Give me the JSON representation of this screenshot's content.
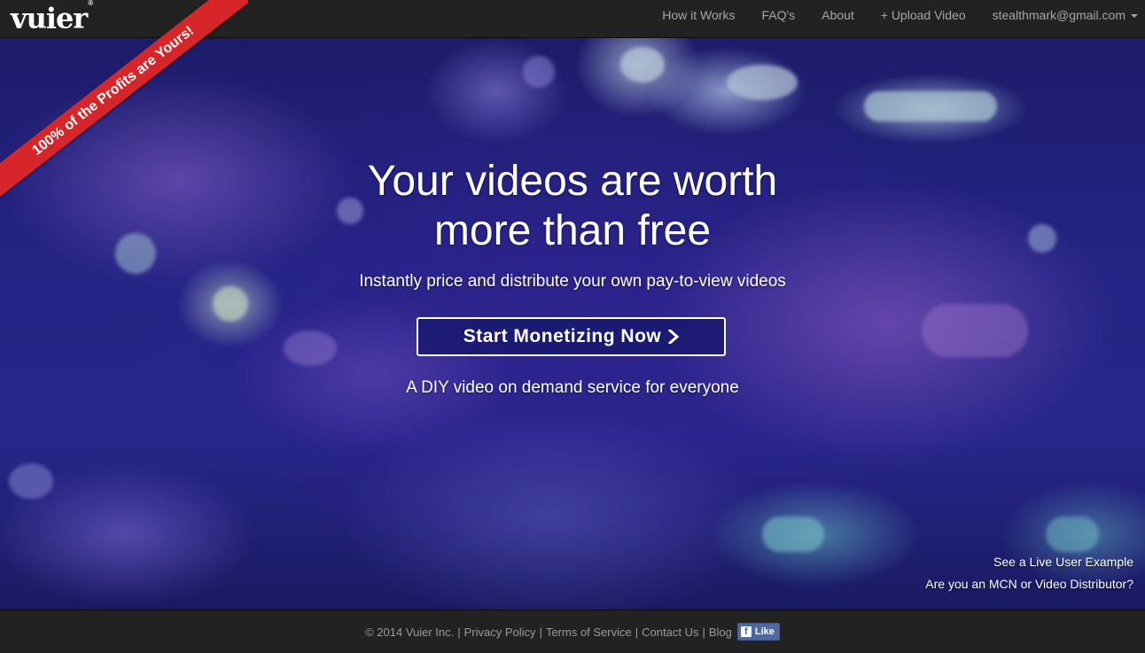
{
  "brand": {
    "logo": "vuier",
    "trademark": "®"
  },
  "ribbon": {
    "text": "100% of the Profits are Yours!",
    "color": "#d7262a"
  },
  "nav": {
    "items": [
      {
        "label": "How it Works"
      },
      {
        "label": "FAQ's"
      },
      {
        "label": "About"
      },
      {
        "label": "+ Upload Video"
      },
      {
        "label": "stealthmark@gmail.com"
      }
    ],
    "account_dropdown_icon": "caret-down-icon"
  },
  "hero": {
    "headline_line1": "Your videos are worth",
    "headline_line2": "more than free",
    "subhead": "Instantly price and distribute your own pay-to-view videos",
    "cta_label": "Start Monetizing Now",
    "cta_icon": "chevron-right-icon",
    "tagline": "A DIY video on demand service for everyone",
    "links": [
      {
        "label": "See a Live User Example"
      },
      {
        "label": "Are you an MCN or Video Distributor?"
      }
    ]
  },
  "footer": {
    "copyright": "© 2014 Vuier Inc.",
    "links": [
      {
        "label": "Privacy Policy"
      },
      {
        "label": "Terms of Service"
      },
      {
        "label": "Contact Us"
      },
      {
        "label": "Blog"
      }
    ],
    "separator": "|",
    "facebook_like": {
      "icon": "facebook-icon",
      "label": "Like",
      "color": "#4e69a2"
    }
  }
}
